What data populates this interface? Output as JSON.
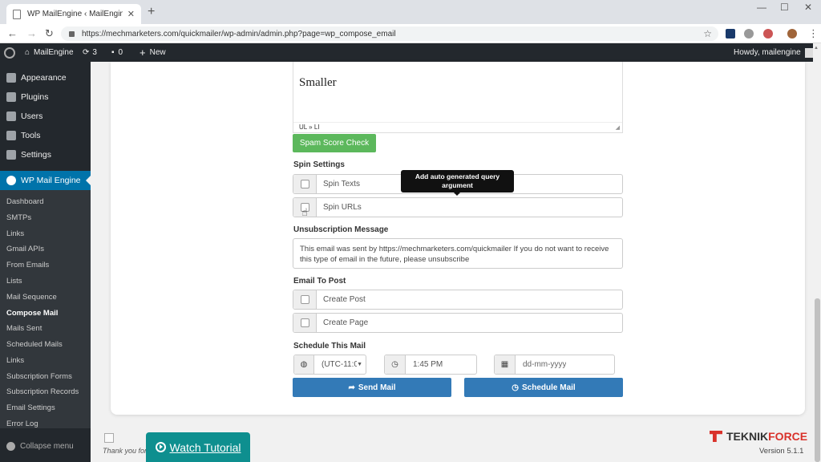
{
  "browser": {
    "tab_title": "WP MailEngine ‹ MailEngine — W",
    "url": "https://mechmarketers.com/quickmailer/wp-admin/admin.php?page=wp_compose_email"
  },
  "adminbar": {
    "site_name": "MailEngine",
    "updates_count": "3",
    "comments_count": "0",
    "new_label": "New",
    "howdy": "Howdy, mailengine"
  },
  "sidebar": {
    "top_items": [
      "Appearance",
      "Plugins",
      "Users",
      "Tools",
      "Settings"
    ],
    "active_item": "WP Mail Engine",
    "submenu": [
      "Dashboard",
      "SMTPs",
      "Links",
      "Gmail APIs",
      "From Emails",
      "Lists",
      "Mail Sequence",
      "Compose Mail",
      "Mails Sent",
      "Scheduled Mails",
      "Links",
      "Subscription Forms",
      "Subscription Records",
      "Email Settings",
      "Error Log"
    ],
    "current_submenu": "Compose Mail",
    "collapse": "Collapse menu"
  },
  "editor": {
    "content": "Smaller",
    "path": "UL » LI"
  },
  "spam_button": "Spam Score Check",
  "spin": {
    "label": "Spin Settings",
    "spin_texts": "Spin Texts",
    "spin_urls": "Spin URLs",
    "tooltip": "Add auto generated query argument"
  },
  "unsubscription": {
    "label": "Unsubscription Message",
    "value": "This email was sent by https://mechmarketers.com/quickmailer If you do not want to receive this type of email in the future, please unsubscribe"
  },
  "email_to_post": {
    "label": "Email To Post",
    "create_post": "Create Post",
    "create_page": "Create Page"
  },
  "schedule": {
    "label": "Schedule This Mail",
    "timezone": "(UTC-11:0",
    "time": "1:45 PM",
    "date_placeholder": "dd-mm-yyyy"
  },
  "send_button": "Send Mail",
  "schedule_button": "Schedule Mail",
  "footer": {
    "thanks": "Thank you for",
    "watch": "Watch Tutorial",
    "brand_a": "TEKNIK",
    "brand_b": "FORCE",
    "version": "Version 5.1.1"
  },
  "colors": {
    "admin_dark": "#23282d",
    "wp_blue": "#0073aa",
    "green": "#5cb85c",
    "primary_blue": "#337ab7",
    "teal": "#0e8f8f"
  }
}
